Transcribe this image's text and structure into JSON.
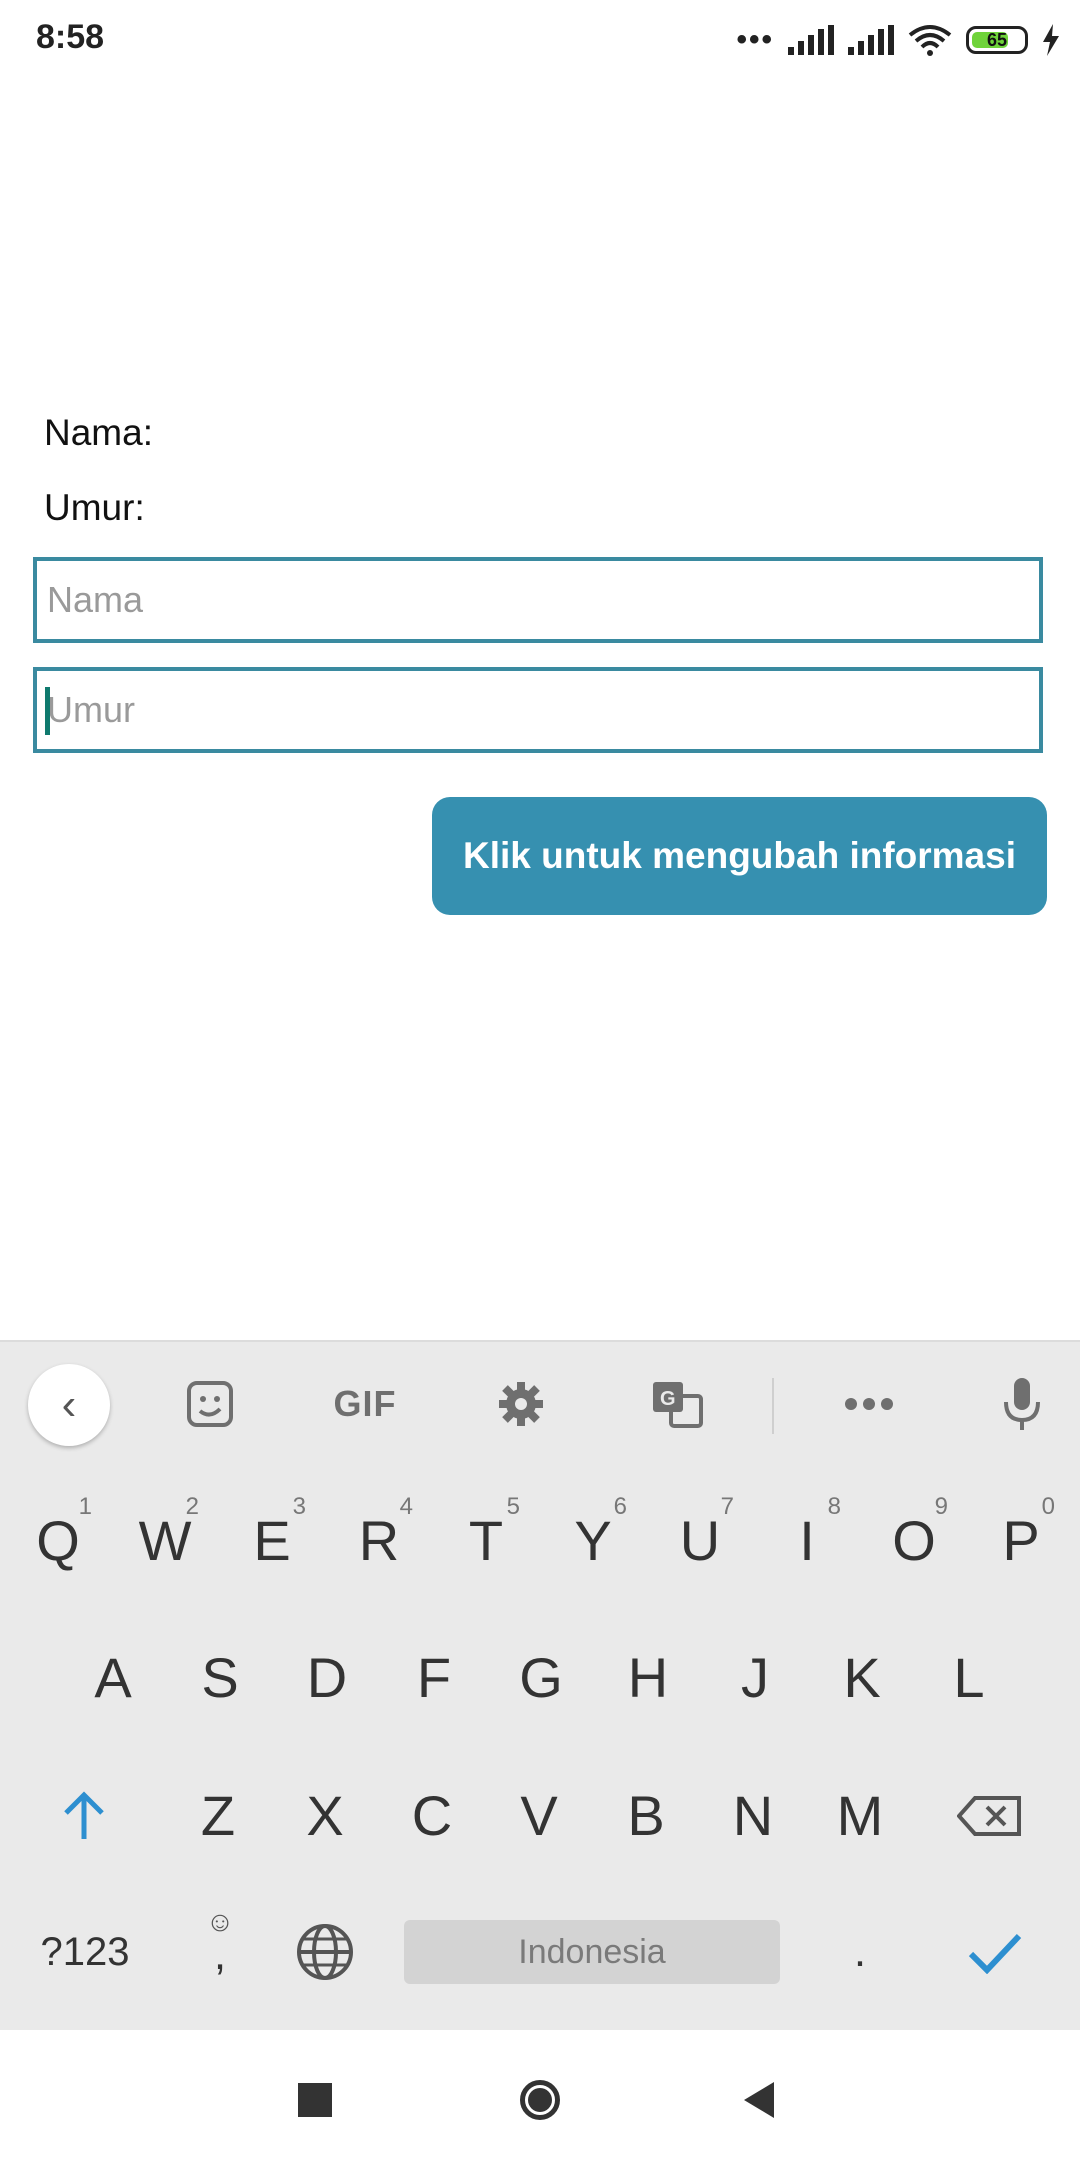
{
  "status_bar": {
    "time": "8:58",
    "battery_level": "65"
  },
  "form": {
    "name_label": "Nama:",
    "age_label": "Umur:",
    "name_placeholder": "Nama",
    "age_placeholder": "Umur",
    "submit_label": "Klik untuk mengubah informasi"
  },
  "keyboard": {
    "toolbar": {
      "back_icon": "chevron-left-icon",
      "sticker_icon": "sticker-icon",
      "gif_label": "GIF",
      "settings_icon": "gear-icon",
      "translate_icon": "translate-icon",
      "more_icon": "more-icon",
      "mic_icon": "mic-icon"
    },
    "row1": [
      {
        "label": "Q",
        "hint": "1"
      },
      {
        "label": "W",
        "hint": "2"
      },
      {
        "label": "E",
        "hint": "3"
      },
      {
        "label": "R",
        "hint": "4"
      },
      {
        "label": "T",
        "hint": "5"
      },
      {
        "label": "Y",
        "hint": "6"
      },
      {
        "label": "U",
        "hint": "7"
      },
      {
        "label": "I",
        "hint": "8"
      },
      {
        "label": "O",
        "hint": "9"
      },
      {
        "label": "P",
        "hint": "0"
      }
    ],
    "row2": [
      "A",
      "S",
      "D",
      "F",
      "G",
      "H",
      "J",
      "K",
      "L"
    ],
    "row3": [
      "Z",
      "X",
      "C",
      "V",
      "B",
      "N",
      "M"
    ],
    "symbols_label": "?123",
    "emoji_label": ",",
    "space_label": "Indonesia",
    "period_label": "."
  },
  "colors": {
    "accent": "#3690b0",
    "field_border": "#3a8aa0",
    "keyboard_blue": "#2d8fd0"
  }
}
